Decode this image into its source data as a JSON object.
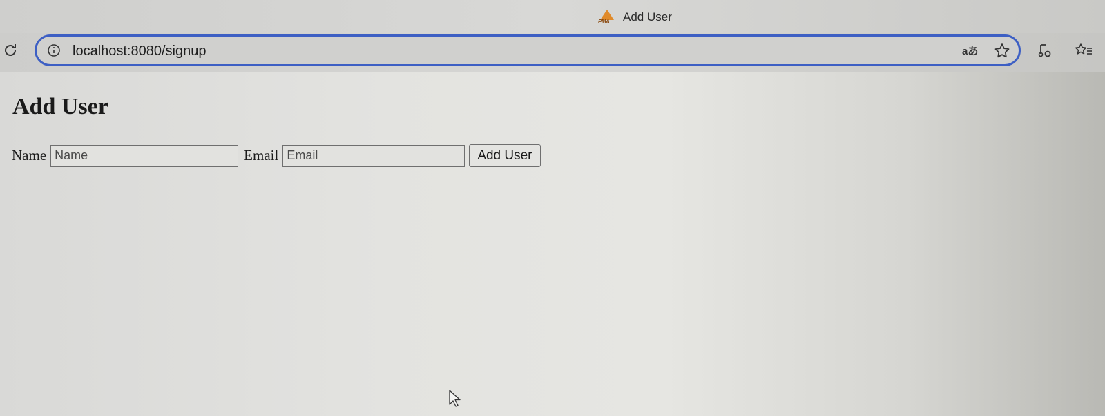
{
  "browser": {
    "tab_title": "Add User",
    "favicon_text": "PMA",
    "url": "localhost:8080/signup",
    "translate_label": "aあ",
    "icons": [
      "reload-icon",
      "info-icon",
      "translate-icon",
      "star-icon",
      "media-icon",
      "favorites-icon"
    ],
    "accent_color": "#3d5fc4"
  },
  "page": {
    "title": "Add User",
    "form": {
      "name_label": "Name",
      "name_placeholder": "Name",
      "email_label": "Email",
      "email_placeholder": "Email",
      "submit_label": "Add User"
    }
  }
}
